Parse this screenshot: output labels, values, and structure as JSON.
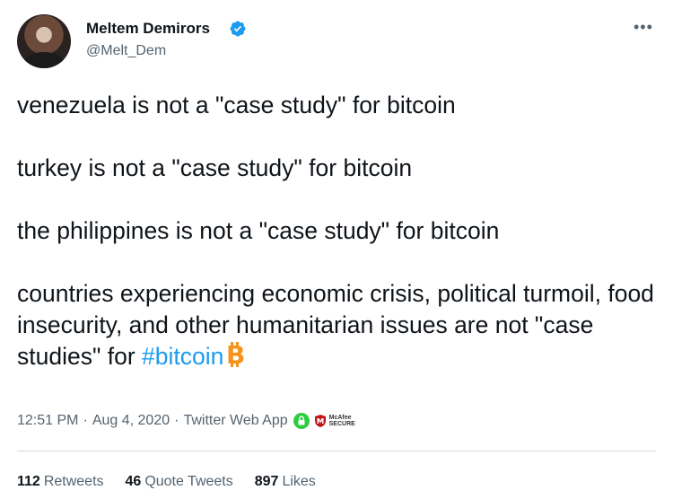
{
  "author": {
    "name": "Meltem Demirors",
    "handle": "@Melt_Dem",
    "verified": true
  },
  "more_icon": "•••",
  "tweet": {
    "paragraphs": [
      "venezuela is not a \"case study\" for bitcoin",
      "turkey is not a \"case study\" for bitcoin",
      "the philippines is not a \"case study\" for bitcoin"
    ],
    "last_paragraph_text": "countries experiencing economic crisis, political turmoil, food insecurity, and other humanitarian issues are not \"case studies\" for",
    "hashtag": "#bitcoin",
    "emoji_icon": "bitcoin-icon"
  },
  "meta": {
    "time": "12:51 PM",
    "separator": "·",
    "date": "Aug 4, 2020",
    "source": "Twitter Web App",
    "mcafee_line1": "McAfee",
    "mcafee_line2": "SECURE"
  },
  "stats": {
    "retweets_count": "112",
    "retweets_label": "Retweets",
    "quote_count": "46",
    "quote_label": "Quote Tweets",
    "likes_count": "897",
    "likes_label": "Likes"
  },
  "colors": {
    "link": "#1d9bf0",
    "verified": "#1d9bf0",
    "bitcoin": "#f7931a",
    "secondary_text": "#536471",
    "lock_green": "#2ecc40",
    "mcafee_red": "#c01818"
  }
}
